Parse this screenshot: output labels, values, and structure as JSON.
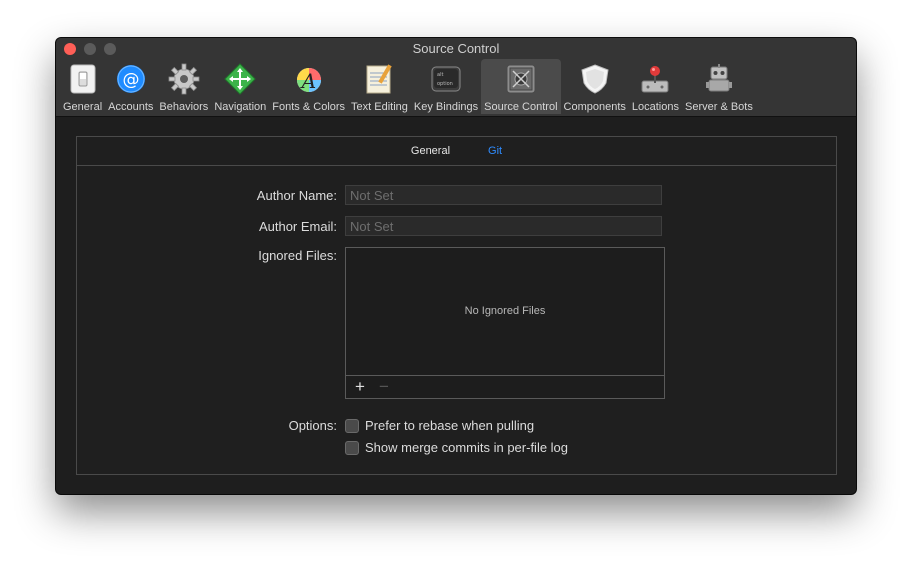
{
  "window": {
    "title": "Source Control"
  },
  "toolbar": {
    "items": [
      {
        "label": "General",
        "icon": "light-switch-icon"
      },
      {
        "label": "Accounts",
        "icon": "at-sign-icon"
      },
      {
        "label": "Behaviors",
        "icon": "gear-icon"
      },
      {
        "label": "Navigation",
        "icon": "navigation-arrows-icon"
      },
      {
        "label": "Fonts & Colors",
        "icon": "font-color-icon"
      },
      {
        "label": "Text Editing",
        "icon": "notepad-icon"
      },
      {
        "label": "Key Bindings",
        "icon": "keyboard-key-icon"
      },
      {
        "label": "Source Control",
        "icon": "safe-icon",
        "selected": true
      },
      {
        "label": "Components",
        "icon": "shield-icon"
      },
      {
        "label": "Locations",
        "icon": "joystick-icon"
      },
      {
        "label": "Server & Bots",
        "icon": "robot-icon"
      }
    ]
  },
  "tabs": {
    "general": "General",
    "git": "Git",
    "selected": "Git"
  },
  "form": {
    "author_name_label": "Author Name:",
    "author_name_placeholder": "Not Set",
    "author_email_label": "Author Email:",
    "author_email_placeholder": "Not Set",
    "ignored_files_label": "Ignored Files:",
    "ignored_empty_text": "No Ignored Files",
    "add_symbol": "+",
    "remove_symbol": "−",
    "options_label": "Options:",
    "option_rebase": "Prefer to rebase when pulling",
    "option_merge": "Show merge commits in per-file log"
  },
  "colors": {
    "close": "#ff5f57",
    "accent": "#2f8cff",
    "window_bg": "#1e1e1e"
  }
}
